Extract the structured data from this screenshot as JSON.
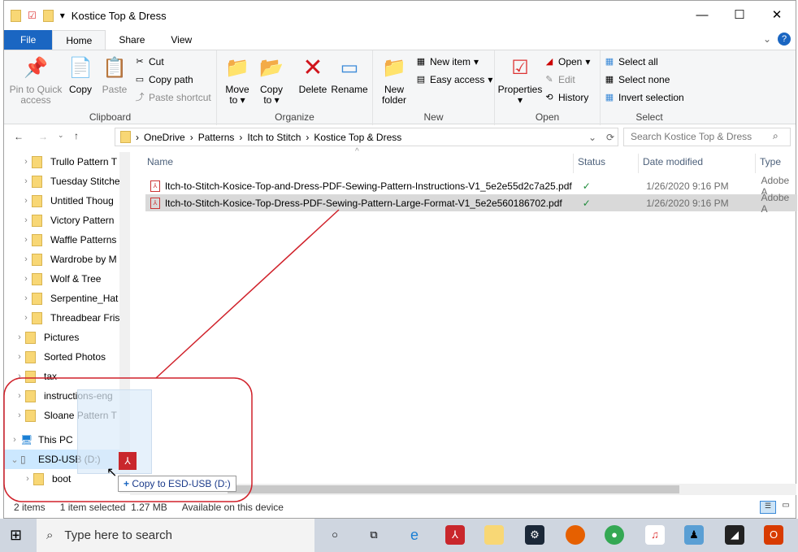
{
  "window": {
    "title": "Kostice Top & Dress",
    "minimize": "—",
    "maximize": "☐",
    "close": "✕"
  },
  "tabs": [
    "File",
    "Home",
    "Share",
    "View"
  ],
  "ribbon": {
    "clipboard": {
      "label": "Clipboard",
      "pin": "Pin to Quick access",
      "copy": "Copy",
      "paste": "Paste",
      "cut": "Cut",
      "copy_path": "Copy path",
      "paste_shortcut": "Paste shortcut"
    },
    "organize": {
      "label": "Organize",
      "move_to": "Move to",
      "copy_to": "Copy to",
      "delete": "Delete",
      "rename": "Rename"
    },
    "new": {
      "label": "New",
      "new_folder": "New folder",
      "new_item": "New item",
      "easy_access": "Easy access"
    },
    "open": {
      "label": "Open",
      "properties": "Properties",
      "open": "Open",
      "edit": "Edit",
      "history": "History"
    },
    "select": {
      "label": "Select",
      "select_all": "Select all",
      "select_none": "Select none",
      "invert": "Invert selection"
    }
  },
  "address": {
    "crumbs": [
      "OneDrive",
      "Patterns",
      "Itch to Stitch",
      "Kostice Top & Dress"
    ],
    "search_placeholder": "Search Kostice Top & Dress"
  },
  "nav": [
    {
      "label": "Trullo Pattern T",
      "type": "folder"
    },
    {
      "label": "Tuesday Stitche",
      "type": "folder"
    },
    {
      "label": "Untitled Thoug",
      "type": "folder"
    },
    {
      "label": "Victory Pattern",
      "type": "folder"
    },
    {
      "label": "Waffle Patterns",
      "type": "folder"
    },
    {
      "label": "Wardrobe by M",
      "type": "folder"
    },
    {
      "label": "Wolf & Tree",
      "type": "folder"
    },
    {
      "label": "Serpentine_Hat",
      "type": "zip"
    },
    {
      "label": "Threadbear Fris",
      "type": "zip"
    },
    {
      "label": "Pictures",
      "type": "folder"
    },
    {
      "label": "Sorted Photos",
      "type": "folder"
    },
    {
      "label": "tax",
      "type": "folder"
    },
    {
      "label": "instructions-eng",
      "type": "zip"
    },
    {
      "label": "Sloane Pattern T",
      "type": "zip"
    },
    {
      "label": "This PC",
      "type": "pc"
    },
    {
      "label": "ESD-USB (D:)",
      "type": "usb"
    },
    {
      "label": "boot",
      "type": "folder"
    }
  ],
  "columns": [
    "Name",
    "Status",
    "Date modified",
    "Type"
  ],
  "files": [
    {
      "name": "Itch-to-Stitch-Kosice-Top-and-Dress-PDF-Sewing-Pattern-Instructions-V1_5e2e55d2c7a25.pdf",
      "status": "✓",
      "date": "1/26/2020 9:16 PM",
      "type": "Adobe A",
      "selected": false
    },
    {
      "name": "Itch-to-Stitch-Kosice-Top-Dress-PDF-Sewing-Pattern-Large-Format-V1_5e2e560186702.pdf",
      "status": "✓",
      "date": "1/26/2020 9:16 PM",
      "type": "Adobe A",
      "selected": true
    }
  ],
  "drag_tooltip": "Copy to ESD-USB (D:)",
  "statusbar": {
    "items": "2 items",
    "selected": "1 item selected  1.27 MB",
    "availability": "Available on this device"
  },
  "taskbar": {
    "search_placeholder": "Type here to search"
  },
  "annotation_color": "#d0212a"
}
